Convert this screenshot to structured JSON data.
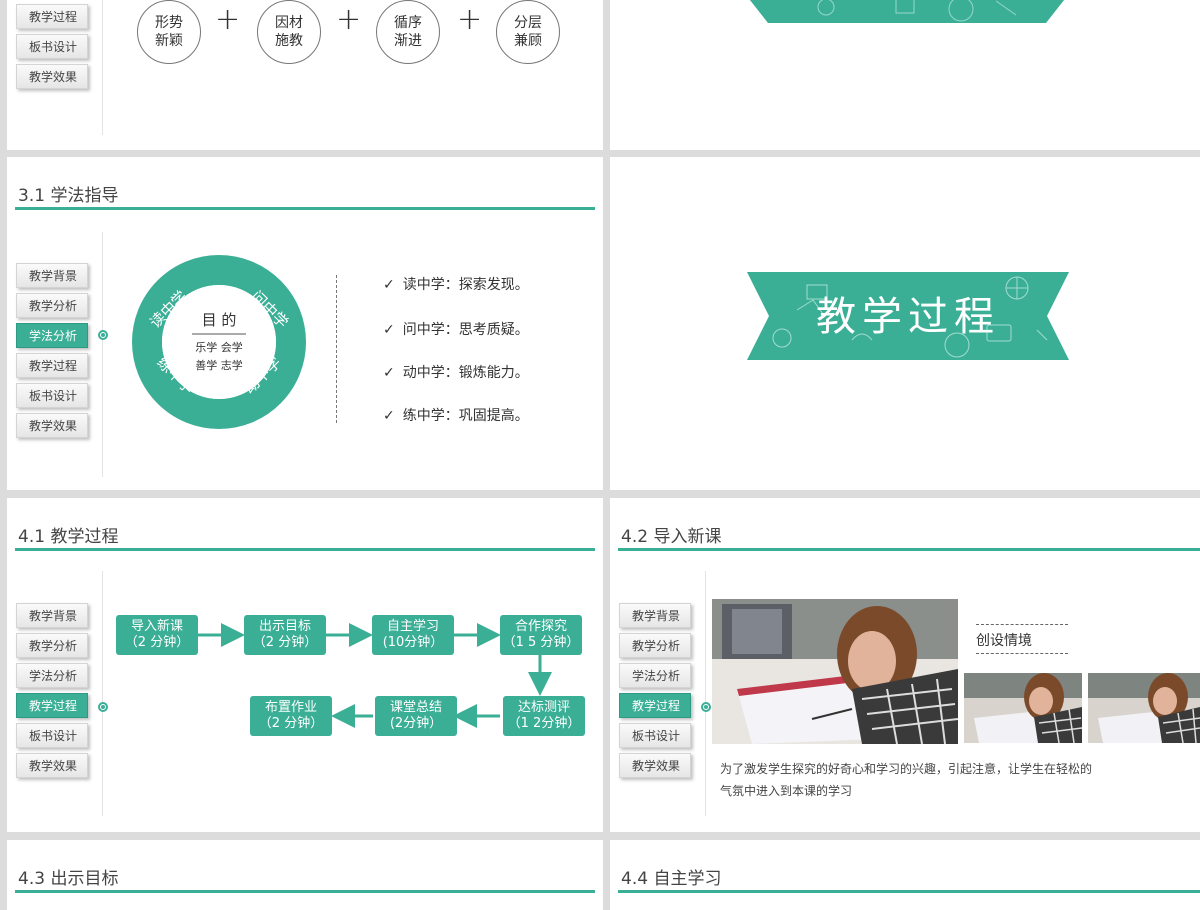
{
  "nav": [
    "教学背景",
    "教学分析",
    "学法分析",
    "教学过程",
    "板书设计",
    "教学效果"
  ],
  "slide1": {
    "nav_visible": [
      "教学过程",
      "板书设计",
      "教学效果"
    ],
    "circles": [
      [
        "形势",
        "新颖"
      ],
      [
        "因材",
        "施教"
      ],
      [
        "循序",
        "渐进"
      ],
      [
        "分层",
        "兼顾"
      ]
    ],
    "plus": "+"
  },
  "slide3": {
    "title": "3.1 学法指导",
    "active": "学法分析",
    "ring_words": [
      "读中学",
      "问中学",
      "练中学",
      "动中学"
    ],
    "center_title": "目 的",
    "center_line1": "乐学 会学",
    "center_line2": "善学 志学",
    "checks": [
      {
        "mark": "✓",
        "text": "读中学：探索发现。"
      },
      {
        "mark": "✓",
        "text": "问中学：思考质疑。"
      },
      {
        "mark": "✓",
        "text": "动中学：锻炼能力。"
      },
      {
        "mark": "✓",
        "text": "练中学：巩固提高。"
      }
    ]
  },
  "slide4": {
    "banner": "教学过程"
  },
  "slide5": {
    "title": "4.1 教学过程",
    "active": "教学过程",
    "steps": [
      {
        "name": "导入新课",
        "time": "（2 分钟）"
      },
      {
        "name": "出示目标",
        "time": "（2 分钟）"
      },
      {
        "name": "自主学习",
        "time": "(10分钟）"
      },
      {
        "name": "合作探究",
        "time": "（1 5 分钟）"
      },
      {
        "name": "达标测评",
        "time": "（1 2分钟）"
      },
      {
        "name": "课堂总结",
        "time": "(2分钟）"
      },
      {
        "name": "布置作业",
        "time": "（2 分钟）"
      }
    ]
  },
  "slide6": {
    "title": "4.2 导入新课",
    "active": "教学过程",
    "tag": "创设情境",
    "desc_line1": "为了激发学生探究的好奇心和学习的兴趣，引起注意，让学生在轻松的",
    "desc_line2": "气氛中进入到本课的学习"
  },
  "slide7": {
    "title": "4.3 出示目标"
  },
  "slide8": {
    "title": "4.4 自主学习"
  },
  "colors": {
    "accent": "#3aaf96",
    "background": "#dcdcdc"
  }
}
